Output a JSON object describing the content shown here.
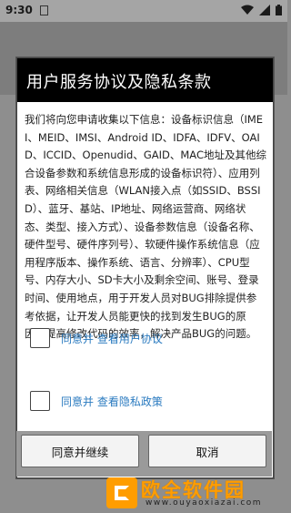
{
  "status_bar": {
    "time": "9:30",
    "wifi_icon": "wifi-icon",
    "signal_icon": "signal-icon",
    "battery_icon": "battery-icon"
  },
  "dialog": {
    "title": "用户服务协议及隐私条款",
    "body": "我们将向您申请收集以下信息：设备标识信息（IMEI、MEID、IMSI、Android ID、IDFA、IDFV、OAID、ICCID、Openudid、GAID、MAC地址及其他综合设备参数和系统信息形成的设备标识符）、应用列表、网络相关信息（WLAN接入点（如SSID、BSSID）、蓝牙、基站、IP地址、网络运营商、网络状态、类型、接入方式）、设备参数信息（设备名称、硬件型号、硬件序列号）、软硬件操作系统信息（应用程序版本、操作系统、语言、分辨率）、CPU型号、内存大小、SD卡大小及剩余空间、账号、登录时间、使用地点，用于开发人员对BUG排除提供参考依据，让开发人员能更快的找到发生BUG的原因，提高修改代码的效率，解决产品BUG的问题。",
    "checkbox_user_agreement": "同意并 查看用户协议",
    "checkbox_privacy_policy": "同意并 查看隐私政策"
  },
  "buttons": {
    "continue": "同意并继续",
    "cancel": "取消"
  },
  "watermark": {
    "name": "欧全软件园",
    "url": "www.ouyaoxiazai.com"
  },
  "colors": {
    "dialog_header_bg": "#000000",
    "link_blue": "#2b7bc0",
    "watermark_orange": "#ff9d00"
  }
}
